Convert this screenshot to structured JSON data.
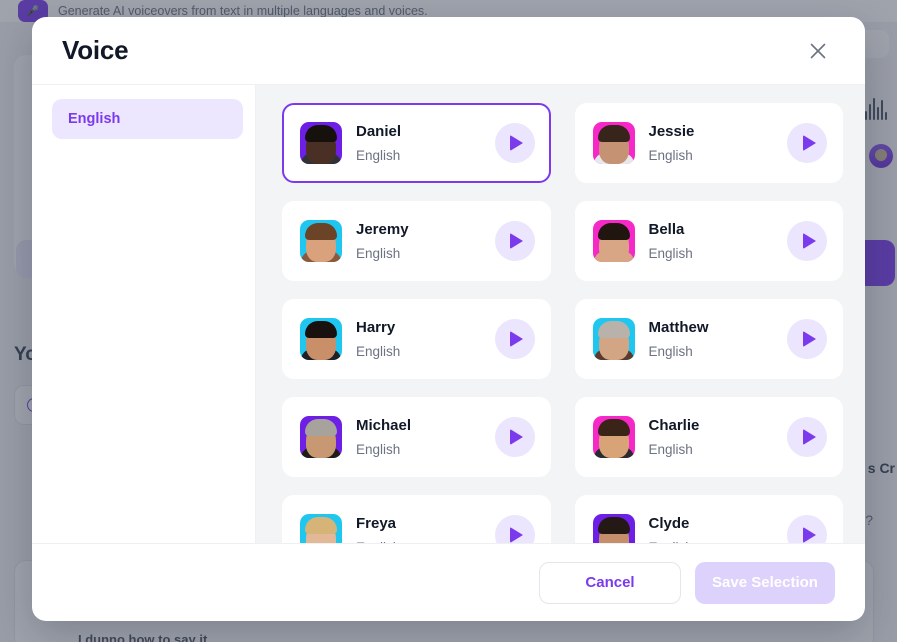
{
  "background": {
    "app_subtitle": "Generate AI voiceovers from text in multiple languages and voices.",
    "app_icon": "microphone-icon",
    "section_heading": "Yo",
    "right_label": "s Cr",
    "right_question": "?",
    "bottom_text": "I dunno how to say it",
    "waveform_icon": "audio-waveform-icon",
    "search_icon": "search-icon"
  },
  "modal": {
    "title": "Voice",
    "close_icon": "close-icon",
    "languages": [
      {
        "label": "English",
        "active": true
      }
    ],
    "voices": [
      {
        "name": "Daniel",
        "language": "English",
        "selected": true,
        "avatar_bg": "#6d1fe6",
        "skin": "#4a2f24",
        "hair": "#17110e",
        "body": "#2f3338"
      },
      {
        "name": "Jessie",
        "language": "English",
        "selected": false,
        "avatar_bg": "#f629c8",
        "skin": "#c69274",
        "hair": "#37241a",
        "body": "#e6e8ec"
      },
      {
        "name": "Jeremy",
        "language": "English",
        "selected": false,
        "avatar_bg": "#1fc7f0",
        "skin": "#d9a17c",
        "hair": "#6b4327",
        "body": "#8a5a3a"
      },
      {
        "name": "Bella",
        "language": "English",
        "selected": false,
        "avatar_bg": "#f629c8",
        "skin": "#d8a585",
        "hair": "#20150f",
        "body": "#d8a585"
      },
      {
        "name": "Harry",
        "language": "English",
        "selected": false,
        "avatar_bg": "#1fc7f0",
        "skin": "#c98f68",
        "hair": "#191110",
        "body": "#1d2024"
      },
      {
        "name": "Matthew",
        "language": "English",
        "selected": false,
        "avatar_bg": "#1fc7f0",
        "skin": "#d2a584",
        "hair": "#b9b2ab",
        "body": "#5a3a2c"
      },
      {
        "name": "Michael",
        "language": "English",
        "selected": false,
        "avatar_bg": "#6d1fe6",
        "skin": "#c79872",
        "hair": "#a7a29c",
        "body": "#1f1b17"
      },
      {
        "name": "Charlie",
        "language": "English",
        "selected": false,
        "avatar_bg": "#f629c8",
        "skin": "#d9a378",
        "hair": "#3a2417",
        "body": "#2a2b30"
      },
      {
        "name": "Freya",
        "language": "English",
        "selected": false,
        "avatar_bg": "#1fc7f0",
        "skin": "#e3b897",
        "hair": "#d6b477",
        "body": "#e7d6c6"
      },
      {
        "name": "Clyde",
        "language": "English",
        "selected": false,
        "avatar_bg": "#6d1fe6",
        "skin": "#c48f6a",
        "hair": "#241914",
        "body": "#20202a"
      }
    ],
    "play_icon": "play-icon",
    "footer": {
      "cancel_label": "Cancel",
      "save_label": "Save Selection",
      "save_disabled": true
    }
  },
  "colors": {
    "accent": "#7c3aed",
    "accent_soft": "#ece7ff",
    "panel_bg": "#f3f4f6",
    "text_primary": "#111827",
    "text_muted": "#6b7280",
    "save_disabled_bg": "#ddd2fb"
  }
}
